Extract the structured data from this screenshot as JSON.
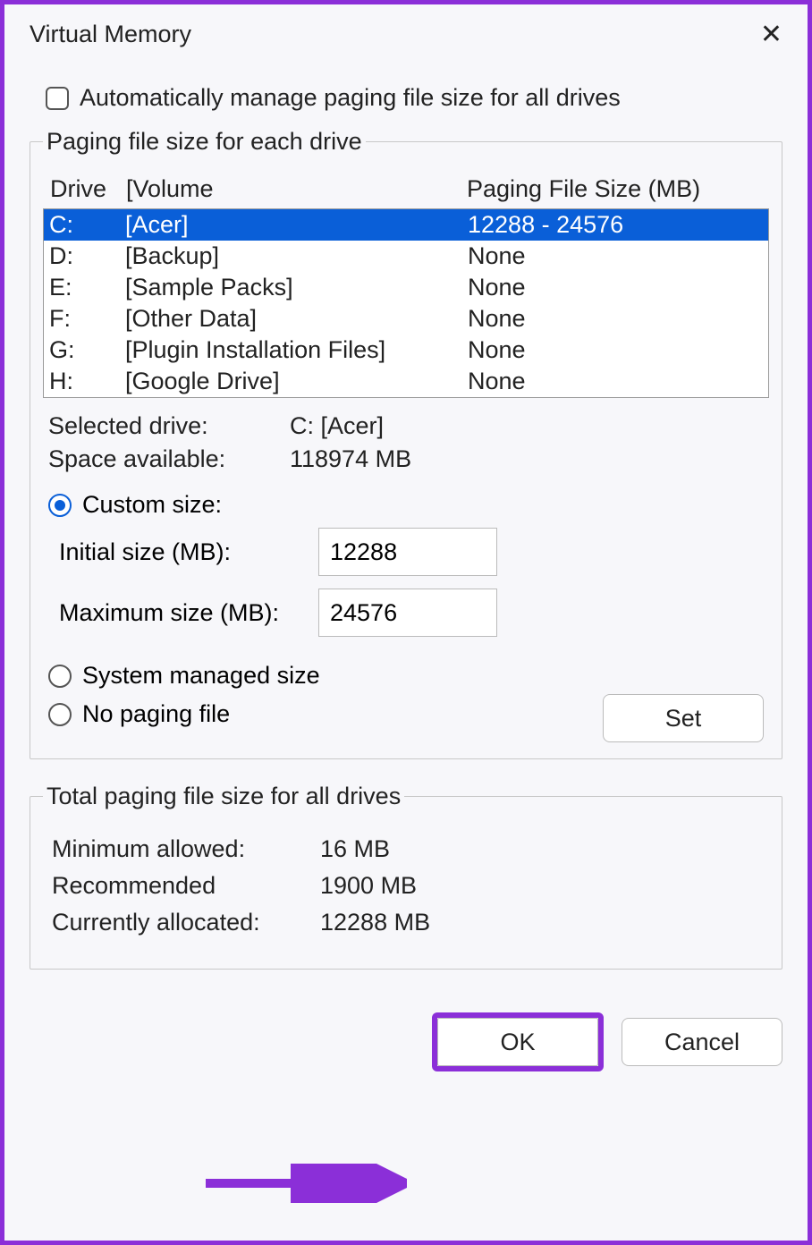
{
  "title": "Virtual Memory",
  "auto_manage_label": "Automatically manage paging file size for all drives",
  "group1": {
    "legend": "Paging file size for each drive",
    "header_drive": "Drive",
    "header_volume": "[Volume",
    "header_size": "Paging File Size (MB)",
    "drives": [
      {
        "letter": "C:",
        "volume": "[Acer]",
        "size": "12288 - 24576",
        "selected": true
      },
      {
        "letter": "D:",
        "volume": "[Backup]",
        "size": "None",
        "selected": false
      },
      {
        "letter": "E:",
        "volume": "[Sample Packs]",
        "size": "None",
        "selected": false
      },
      {
        "letter": "F:",
        "volume": "[Other Data]",
        "size": "None",
        "selected": false
      },
      {
        "letter": "G:",
        "volume": "[Plugin Installation Files]",
        "size": "None",
        "selected": false
      },
      {
        "letter": "H:",
        "volume": "[Google Drive]",
        "size": "None",
        "selected": false
      }
    ],
    "selected_drive_label": "Selected drive:",
    "selected_drive_value": "C:  [Acer]",
    "space_label": "Space available:",
    "space_value": "118974 MB",
    "radio_custom": "Custom size:",
    "initial_label": "Initial size (MB):",
    "initial_value": "12288",
    "maximum_label": "Maximum size (MB):",
    "maximum_value": "24576",
    "radio_system": "System managed size",
    "radio_none": "No paging file",
    "set_button": "Set"
  },
  "group2": {
    "legend": "Total paging file size for all drives",
    "min_label": "Minimum allowed:",
    "min_value": "16 MB",
    "rec_label": "Recommended",
    "rec_value": "1900 MB",
    "cur_label": "Currently allocated:",
    "cur_value": "12288 MB"
  },
  "buttons": {
    "ok": "OK",
    "cancel": "Cancel"
  }
}
